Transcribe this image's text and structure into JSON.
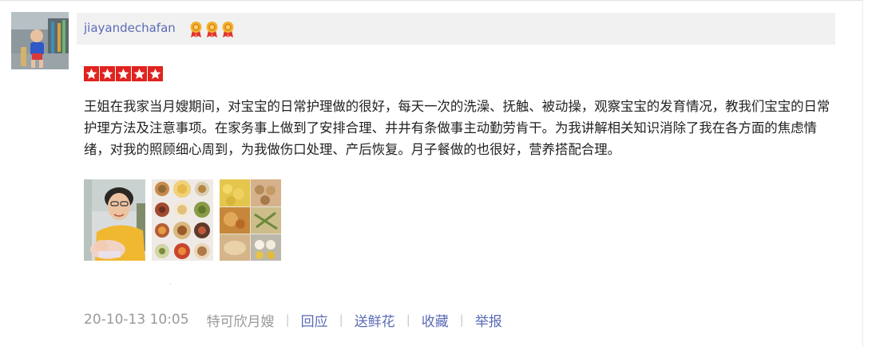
{
  "review": {
    "username": "jiayandechafan",
    "medal_icon": "medal-icon",
    "medal_count": 3,
    "rating": 5,
    "rating_max": 5,
    "text": "王姐在我家当月嫂期间，对宝宝的日常护理做的很好，每天一次的洗澡、抚触、被动操，观察宝宝的发育情况，教我们宝宝的日常护理方法及注意事项。在家务事上做到了安排合理、井井有条做事主动勤劳肯干。为我讲解相关知识消除了我在各方面的焦虑情绪，对我的照顾细心周到，为我做伤口处理、产后恢复。月子餐做的也很好，营养搭配合理。",
    "photos": [
      "photo-mother-baby",
      "photo-meal-collage-1",
      "photo-meal-collage-2"
    ],
    "date": "20-10-13 10:05",
    "author": "特可欣月嫂",
    "separator": "|",
    "actions": {
      "reply": "回应",
      "send_flowers": "送鲜花",
      "favorite": "收藏",
      "report": "举报"
    }
  },
  "colors": {
    "link": "#5b6bb6",
    "star_bg": "#e1231f",
    "header_bg": "#f1f1f1",
    "muted": "#999999"
  }
}
